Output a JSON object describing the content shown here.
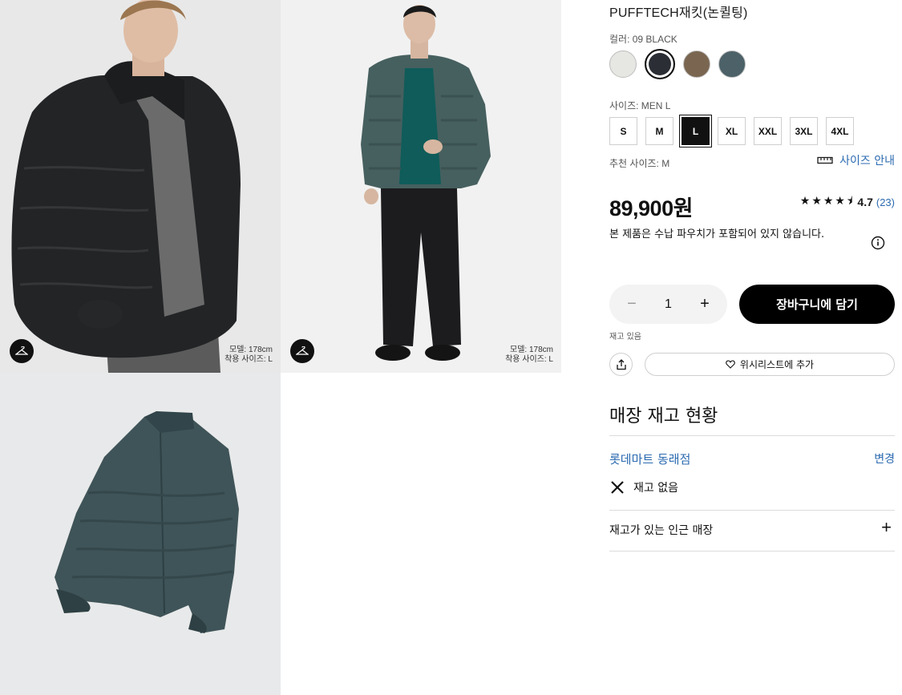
{
  "gallery": {
    "photos": [
      {
        "model_height": "모델: 178cm",
        "model_size": "착용 사이즈: L"
      },
      {
        "model_height": "모델: 178cm",
        "model_size": "착용 사이즈: L"
      }
    ],
    "icons": {
      "hanger": "hanger-icon"
    }
  },
  "product": {
    "name": "PUFFTECH재킷(논퀼팅)",
    "color_label": "컬러: 09 BLACK",
    "colors": [
      "#e6e6e2",
      "#2b2e35",
      "#7a6650",
      "#4c6168"
    ],
    "selected_color_index": 1,
    "size_label": "사이즈: MEN L",
    "sizes": [
      "S",
      "M",
      "L",
      "XL",
      "XXL",
      "3XL",
      "4XL"
    ],
    "selected_size": "L",
    "recommended_size": "추천 사이즈: M",
    "size_guide": "사이즈 안내",
    "price": "89,900원",
    "rating": {
      "stars": 4.5,
      "value": "4.7",
      "count": "(23)"
    },
    "notice": "본 제품은 수납 파우치가 포함되어 있지 않습니다.",
    "quantity": {
      "minus": "−",
      "value": "1",
      "plus": "+"
    },
    "add_to_cart": "장바구니에 담기",
    "stock_status": "재고 있음",
    "wishlist": "위시리스트에 추가"
  },
  "store": {
    "title": "매장 재고 현황",
    "name": "롯데마트 동래점",
    "change": "변경",
    "availability": "재고 없음",
    "nearby": "재고가 있는 인근 매장",
    "nearby_toggle": "+"
  }
}
